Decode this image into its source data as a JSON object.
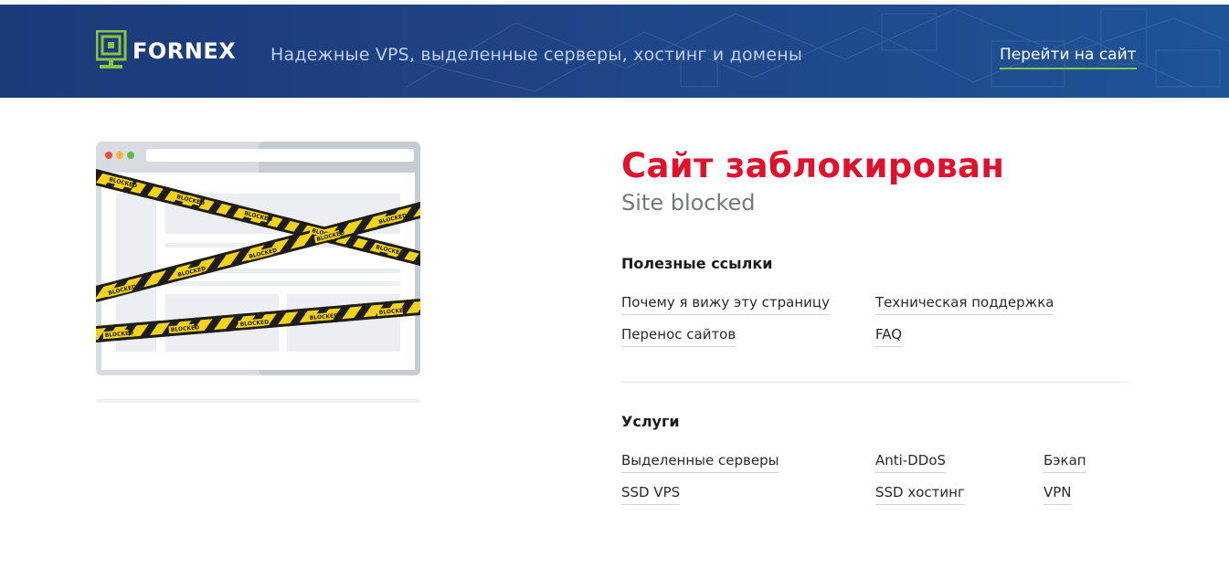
{
  "header": {
    "brand_name": "FORNEX",
    "tagline": "Надежные VPS, выделенные серверы, хостинг и домены",
    "goto_link": "Перейти на сайт"
  },
  "illustration": {
    "tape_label": "BLOCKED"
  },
  "main": {
    "title": "Сайт заблокирован",
    "subtitle": "Site blocked",
    "useful_links": {
      "heading": "Полезные ссылки",
      "items": [
        "Почему я вижу эту страницу",
        "Техническая поддержка",
        "Перенос сайтов",
        "FAQ"
      ]
    },
    "services": {
      "heading": "Услуги",
      "items": [
        "Выделенные серверы",
        "Anti-DDoS",
        "Бэкап",
        "SSD VPS",
        "SSD хостинг",
        "VPN"
      ]
    }
  },
  "colors": {
    "header_bg": "#1f4486",
    "accent_green": "#8ac43f",
    "title_red": "#e30f2b",
    "tape_yellow": "#f4d21a"
  }
}
